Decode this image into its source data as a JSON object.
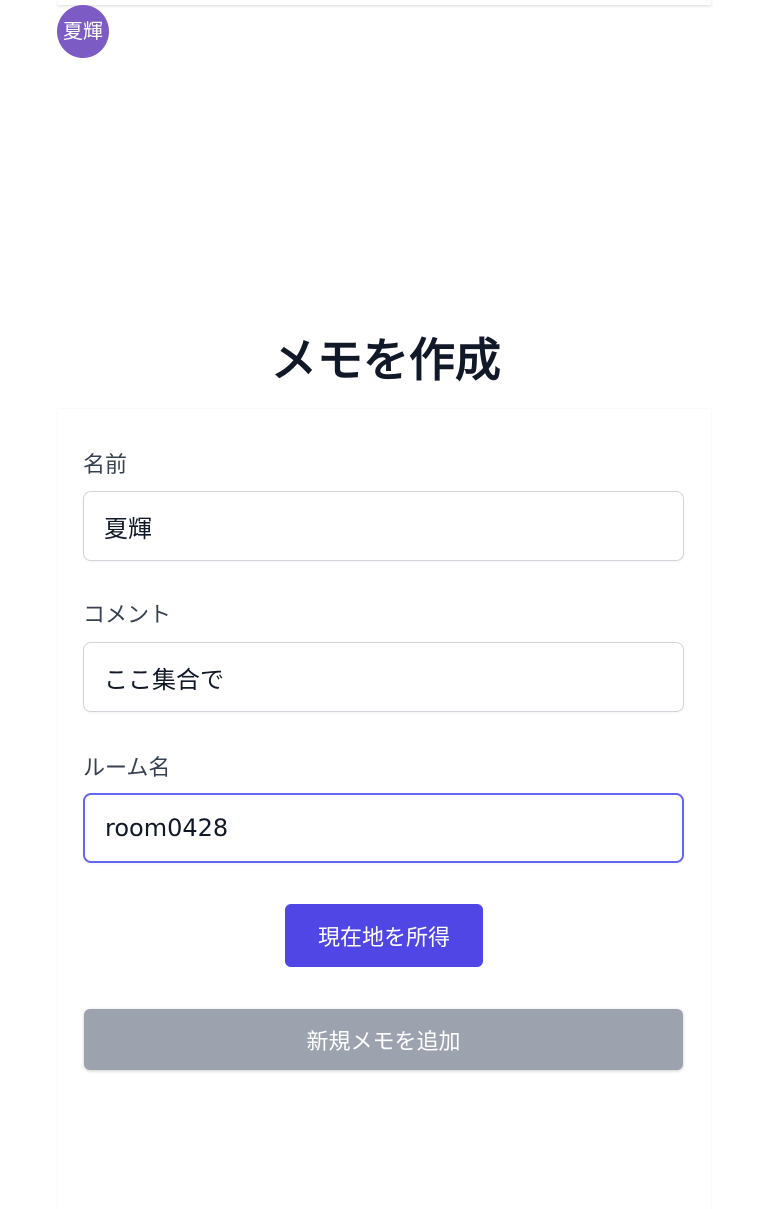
{
  "header": {
    "avatar_text": "夏輝"
  },
  "page_title": "メモを作成",
  "form": {
    "name": {
      "label": "名前",
      "value": "夏輝"
    },
    "comment": {
      "label": "コメント",
      "value": "ここ集合で"
    },
    "room": {
      "label": "ルーム名",
      "value": "room0428"
    },
    "get_location_label": "現在地を所得",
    "add_memo_label": "新規メモを追加"
  },
  "colors": {
    "avatar": "#7c5cc4",
    "primary": "#4f46e5",
    "disabled": "#9ca3af",
    "focus_border": "#6366f1"
  }
}
